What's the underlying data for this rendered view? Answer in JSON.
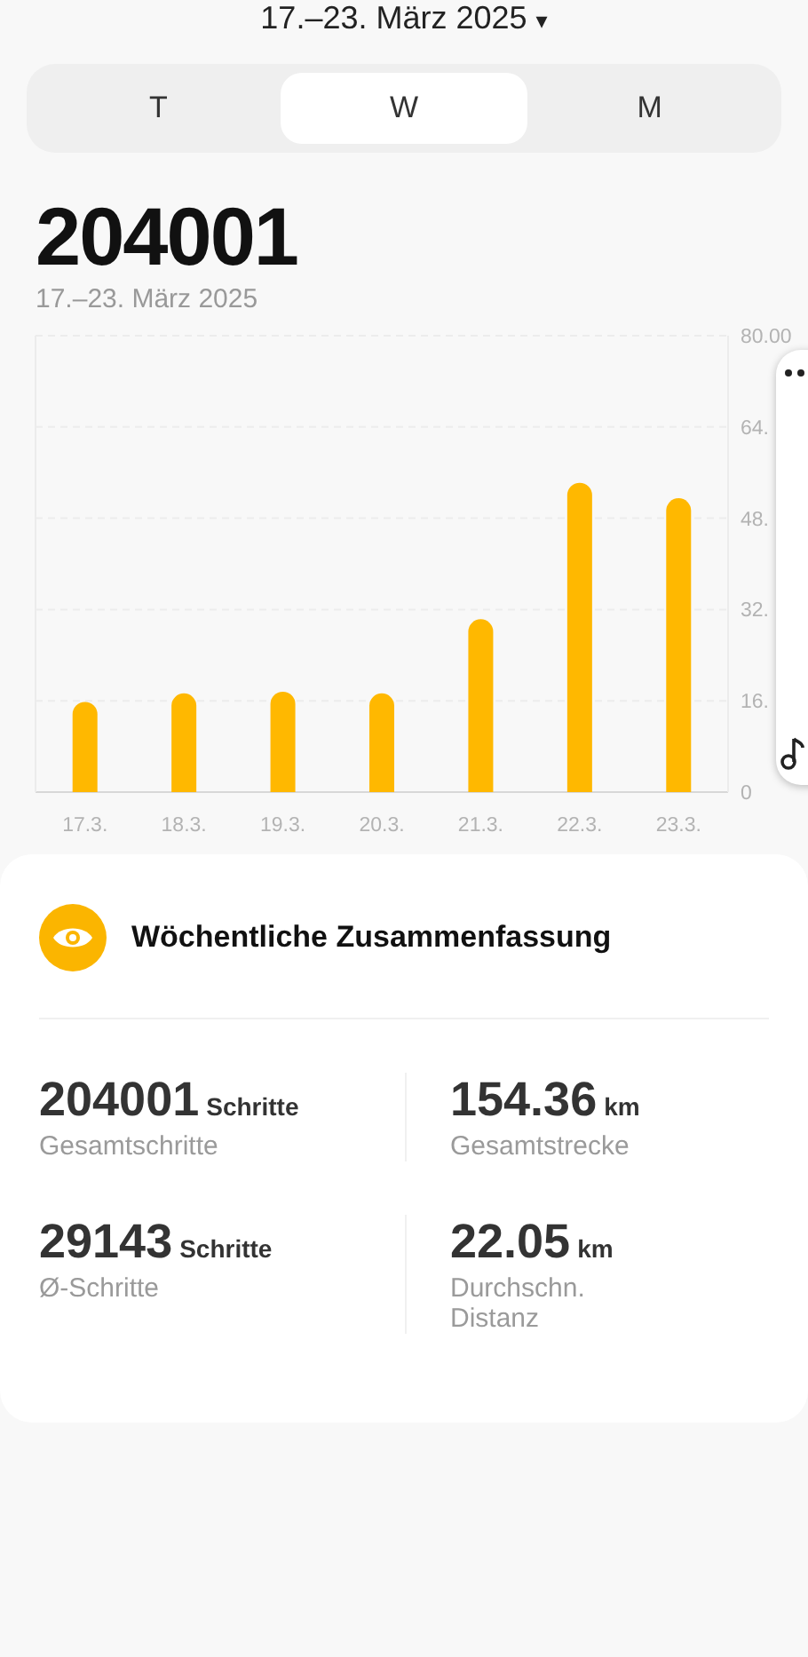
{
  "date_picker": {
    "label": "17.–23. März 2025",
    "caret": "▾"
  },
  "tabs": [
    {
      "label": "T",
      "selected": false
    },
    {
      "label": "W",
      "selected": true
    },
    {
      "label": "M",
      "selected": false
    }
  ],
  "total": "204001",
  "range": "17.–23. März 2025",
  "chart": {
    "chart_data": {
      "type": "bar",
      "categories": [
        "17.3.",
        "18.3.",
        "19.3.",
        "20.3.",
        "21.3.",
        "22.3.",
        "23.3."
      ],
      "series": [
        {
          "color": "#ffb800",
          "values": [
            15.8,
            17.3,
            17.6,
            17.3,
            30.3,
            54.2,
            51.5
          ]
        }
      ],
      "ylim": [
        0,
        80
      ],
      "grid": true,
      "yticks": [
        {
          "value": 0,
          "label": "0"
        },
        {
          "value": 16,
          "label": "16."
        },
        {
          "value": 32,
          "label": "32."
        },
        {
          "value": 48,
          "label": "48."
        },
        {
          "value": 64,
          "label": "64."
        },
        {
          "value": 80,
          "label": "80.00"
        }
      ]
    }
  },
  "summary": {
    "title": "Wöchentliche Zusammenfassung",
    "stats": [
      {
        "value": "204001",
        "unit": "Schritte",
        "label": "Gesamtschritte"
      },
      {
        "value": "154.36",
        "unit": "km",
        "label": "Gesamtstrecke"
      },
      {
        "value": "29143",
        "unit": "Schritte",
        "label": "Ø-Schritte"
      },
      {
        "value": "22.05",
        "unit": "km",
        "label": "Durchschn. Distanz"
      }
    ]
  }
}
